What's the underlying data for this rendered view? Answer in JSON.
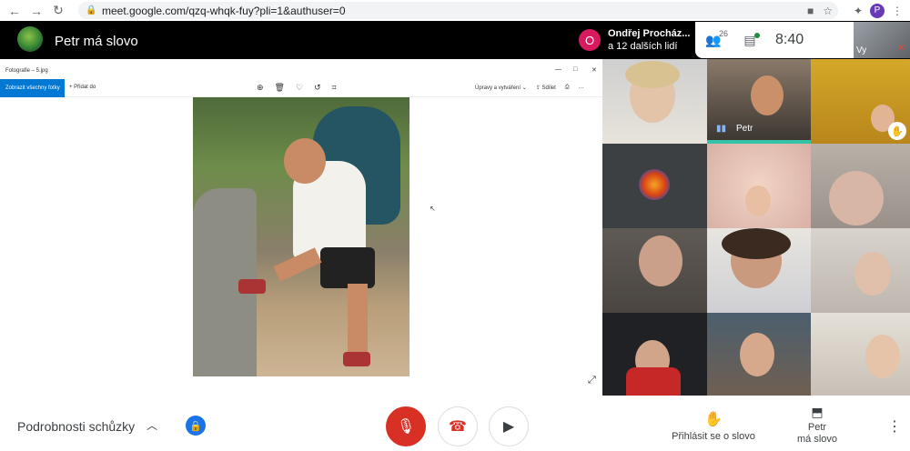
{
  "browser": {
    "url": "meet.google.com/qzq-whqk-fuy?pli=1&authuser=0",
    "profile_initial": "P"
  },
  "meet": {
    "presenter_title": "Petr má slovo",
    "notification": {
      "avatar_initial": "O",
      "line1": "Ondřej Procház...",
      "line2": "a 12 dalších lidí"
    },
    "participant_count": "26",
    "clock": "8:40",
    "self_label": "Vy"
  },
  "presentation": {
    "window_title": "Fotografie – 5.jpg",
    "view_all": "Zobrazit všechny fotky",
    "add_to": "Přidat do",
    "edit_create": "Úpravy a vytváření",
    "share": "Sdílet"
  },
  "grid": {
    "tiles": [
      {
        "name": ""
      },
      {
        "name": "Petr"
      },
      {
        "name": ""
      },
      {
        "name": ""
      },
      {
        "name": ""
      },
      {
        "name": ""
      },
      {
        "name": ""
      },
      {
        "name": ""
      },
      {
        "name": ""
      },
      {
        "name": ""
      },
      {
        "name": ""
      },
      {
        "name": ""
      }
    ]
  },
  "bottom": {
    "details_label": "Podrobnosti schůzky",
    "raise_hand_label": "Přihlásit se o slovo",
    "present_label_1": "Petr",
    "present_label_2": "má slovo"
  },
  "colors": {
    "mic_off_red": "#d93025",
    "accent_blue": "#1a73e8",
    "speaking_teal": "#34c3a8"
  }
}
